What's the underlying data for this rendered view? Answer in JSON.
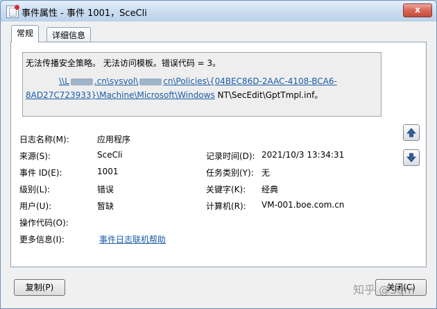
{
  "window": {
    "title": "事件属性 - 事件 1001，SceCli",
    "close_label": "x"
  },
  "tabs": [
    {
      "label": "常规"
    },
    {
      "label": "详细信息"
    }
  ],
  "message": {
    "line1": "无法传播安全策略。 无法访问模板。错误代码 = 3。",
    "line2_prefix": "\\\\L",
    "line2_mid": ".cn\\sysvol\\",
    "line2_suffix": "cn\\Policies\\{04BEC86D-2AAC-4108-BCA6-",
    "line3_link": "8AD27C723933}\\Machine\\Microsoft\\Windows",
    "line3_rest": " NT\\SecEdit\\GptTmpl.inf。"
  },
  "fields": {
    "log_name": {
      "label": "日志名称(M):",
      "value": "应用程序"
    },
    "source": {
      "label": "来源(S):",
      "value": "SceCli"
    },
    "event_id": {
      "label": "事件 ID(E):",
      "value": "1001"
    },
    "level": {
      "label": "级别(L):",
      "value": "错误"
    },
    "user": {
      "label": "用户(U):",
      "value": "暂缺"
    },
    "opcode": {
      "label": "操作代码(O):",
      "value": ""
    },
    "more_info": {
      "label": "更多信息(I):",
      "value": "事件日志联机帮助"
    },
    "logged": {
      "label": "记录时间(D):",
      "value": "2021/10/3 13:34:31"
    },
    "task_category": {
      "label": "任务类别(Y):",
      "value": "无"
    },
    "keywords": {
      "label": "关键字(K):",
      "value": "经典"
    },
    "computer": {
      "label": "计算机(R):",
      "value": "VM-001.boe.com.cn"
    }
  },
  "buttons": {
    "copy": "复制(P)",
    "close": "关闭(C)"
  },
  "watermark": "知乎 @Sqm",
  "icons": {
    "up": "arrow-up-icon",
    "down": "arrow-down-icon"
  }
}
